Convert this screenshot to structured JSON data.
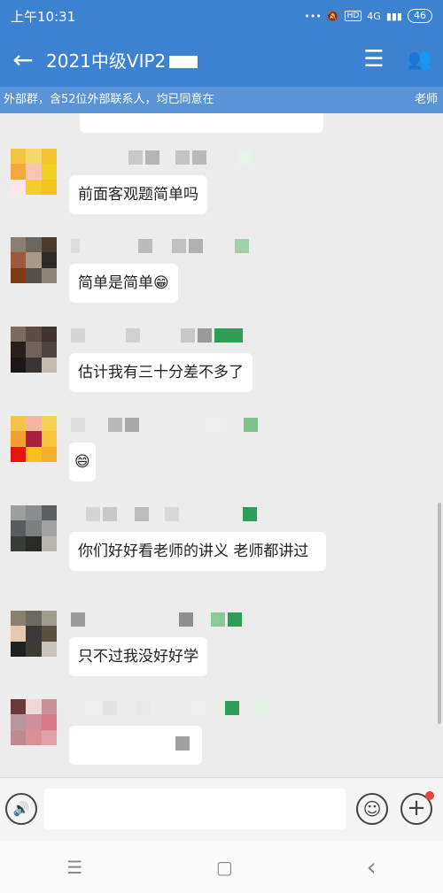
{
  "status": {
    "time": "上午10:31",
    "network": "4G",
    "battery": "46",
    "hd": "HD"
  },
  "header": {
    "back_icon": "←",
    "title": "2021中级VIP2",
    "menu_icon": "☰",
    "members_icon": "👥"
  },
  "notice": {
    "text": "外部群，含52位外部联系人，均已同意在",
    "right": "老师"
  },
  "messages": [
    {
      "text": "前面客观题简单吗"
    },
    {
      "text": "简单是简单😁"
    },
    {
      "text": "估计我有三十分差不多了"
    },
    {
      "text": "😄"
    },
    {
      "text": "你们好好看老师的讲义 老师都讲过"
    },
    {
      "text": "只不过我没好好学"
    },
    {
      "text": ""
    }
  ],
  "input": {
    "placeholder": "",
    "voice_icon": "🔊",
    "emoji_icon": "☺",
    "plus_icon": "+"
  },
  "nav": {
    "menu": "☰",
    "home": "▢",
    "back": "‹"
  }
}
